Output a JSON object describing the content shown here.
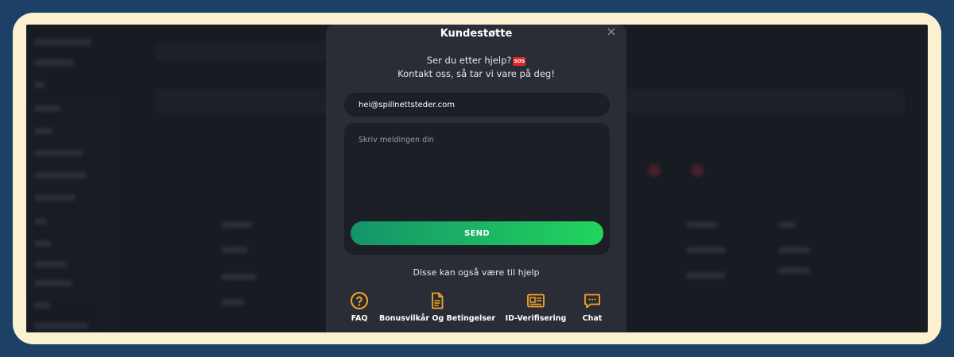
{
  "modal": {
    "title": "Kundestøtte",
    "close_symbol": "×",
    "intro_line1": "Ser du etter hjelp?",
    "sos_badge": "SOS",
    "intro_line2": "Kontakt oss, så tar vi vare på deg!",
    "email_value": "hei@spillnettsteder.com",
    "message_placeholder": "Skriv meldingen din",
    "send_label": "SEND",
    "help_heading": "Disse kan også være til hjelp",
    "help_links": [
      {
        "label": "FAQ",
        "icon": "question-circle-icon"
      },
      {
        "label": "Bonusvilkår Og Betingelser",
        "icon": "document-icon"
      },
      {
        "label": "ID-Verifisering",
        "icon": "id-card-icon"
      },
      {
        "label": "Chat",
        "icon": "chat-bubble-icon"
      }
    ]
  },
  "colors": {
    "accent_orange": "#f5a623",
    "send_gradient_start": "#14946a",
    "send_gradient_end": "#22d45d",
    "modal_bg": "#2b2d36",
    "frame_blue": "#1c4066",
    "frame_cream": "#fbf0cf"
  }
}
